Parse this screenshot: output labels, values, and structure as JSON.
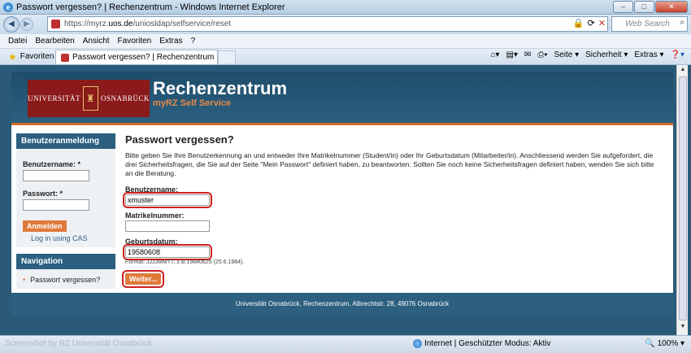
{
  "window": {
    "title": "Passwort vergessen? | Rechenzentrum - Windows Internet Explorer",
    "minimize": "–",
    "maximize": "□",
    "close": "✕"
  },
  "address": {
    "url_prefix": "https://myrz.",
    "url_domain": "uos.de",
    "url_path": "/uniosldap/selfservice/reset",
    "search_placeholder": "Web Search"
  },
  "menu": [
    "Datei",
    "Bearbeiten",
    "Ansicht",
    "Favoriten",
    "Extras",
    "?"
  ],
  "tabbar": {
    "favorites": "Favoriten",
    "active_tab": "Passwort vergessen? | Rechenzentrum",
    "cmd_page": "Seite ▾",
    "cmd_security": "Sicherheit ▾",
    "cmd_tools": "Extras ▾"
  },
  "header": {
    "logo_left": "UNIVERSITÄT",
    "logo_right": "OSNABRÜCK",
    "title": "Rechenzentrum",
    "subtitle": "myRZ Self Service"
  },
  "sidebar": {
    "login_heading": "Benutzeranmeldung",
    "username_label": "Benutzername: *",
    "password_label": "Passwort: *",
    "login_button": "Anmelden",
    "cas_link": "Log in using CAS",
    "nav_heading": "Navigation",
    "nav_item": "Passwort vergessen?"
  },
  "main": {
    "heading": "Passwort vergessen?",
    "intro": "Bitte geben Sie Ihre Benutzerkennung an und entweder Ihre Matrikelnummer (Student/in) oder Ihr Geburtsdatum (Mitarbeiter/in). Anschliessend werden Sie aufgefordert, die drei Sicherheitsfragen, die Sie auf der Seite \"Mein Passwort\" definiert haben, zu beantworten. Sollten Sie noch keine Sicherheitsfragen definiert haben, wenden Sie sich bitte an die Beratung.",
    "username_label": "Benutzername:",
    "username_value": "xmuster",
    "matrikel_label": "Matrikelnummer:",
    "matrikel_value": "",
    "birth_label": "Geburtsdatum:",
    "birth_value": "19580608",
    "birth_hint": "Format: JJJJMMTT, z.B.19840625 (25.6.1984).",
    "submit": "Weiter..."
  },
  "footer": "Universität Osnabrück, Rechenzentrum, Albrechtstr. 28, 49076 Osnabrück",
  "status": {
    "watermark": "Screenshot by RZ Universität Osnabrück",
    "zone": "Internet | Geschützter Modus: Aktiv",
    "zoom": "100%"
  }
}
